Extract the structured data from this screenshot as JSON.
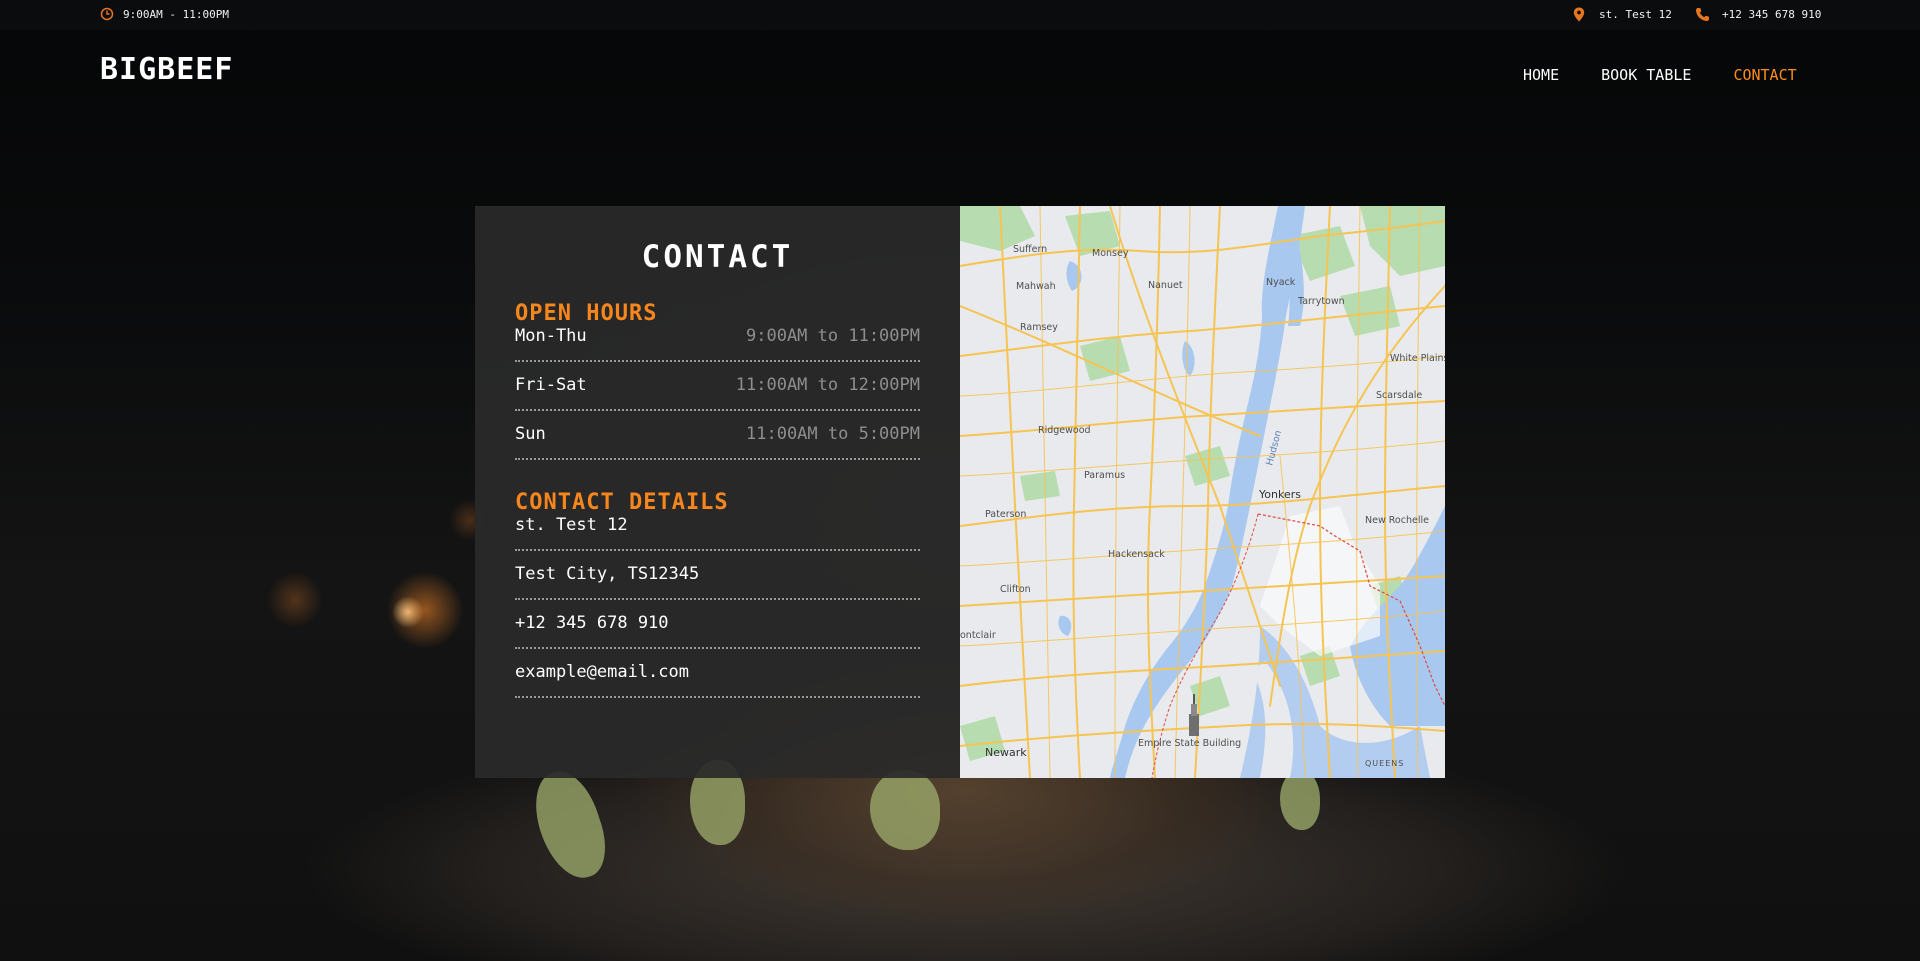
{
  "topbar": {
    "hours": "9:00AM - 11:00PM",
    "address": "st. Test 12",
    "phone": "+12 345 678 910"
  },
  "header": {
    "brand": "BIGBEEF",
    "nav": [
      {
        "label": "HOME"
      },
      {
        "label": "BOOK TABLE"
      },
      {
        "label": "CONTACT",
        "active": true
      }
    ]
  },
  "contact": {
    "title": "CONTACT",
    "open_hours_title": "OPEN HOURS",
    "hours": [
      {
        "day": "Mon-Thu",
        "time": "9:00AM to 11:00PM"
      },
      {
        "day": "Fri-Sat",
        "time": "11:00AM to 12:00PM"
      },
      {
        "day": "Sun",
        "time": "11:00AM to 5:00PM"
      }
    ],
    "details_title": "CONTACT DETAILS",
    "details": [
      "st. Test 12",
      "Test City, TS12345",
      "+12 345 678 910",
      "example@email.com"
    ]
  },
  "map": {
    "labels": {
      "suffern": "Suffern",
      "monsey": "Monsey",
      "nanuet": "Nanuet",
      "nyack": "Nyack",
      "tarrytown": "Tarrytown",
      "mahwah": "Mahwah",
      "ramsey": "Ramsey",
      "white_plains": "White Plains",
      "scarsdale": "Scarsdale",
      "ridgewood": "Ridgewood",
      "hudson": "Hudson",
      "paramus": "Paramus",
      "yonkers": "Yonkers",
      "paterson": "Paterson",
      "new_rochelle": "New Rochelle",
      "hackensack": "Hackensack",
      "clifton": "Clifton",
      "montclair": "ontclair",
      "empire": "Empire State Building",
      "newark": "Newark",
      "queens": "QUEENS"
    }
  },
  "colors": {
    "accent": "#f7861d",
    "card_bg": "#2a2a2a",
    "topbar_bg": "#0b0c0d"
  }
}
